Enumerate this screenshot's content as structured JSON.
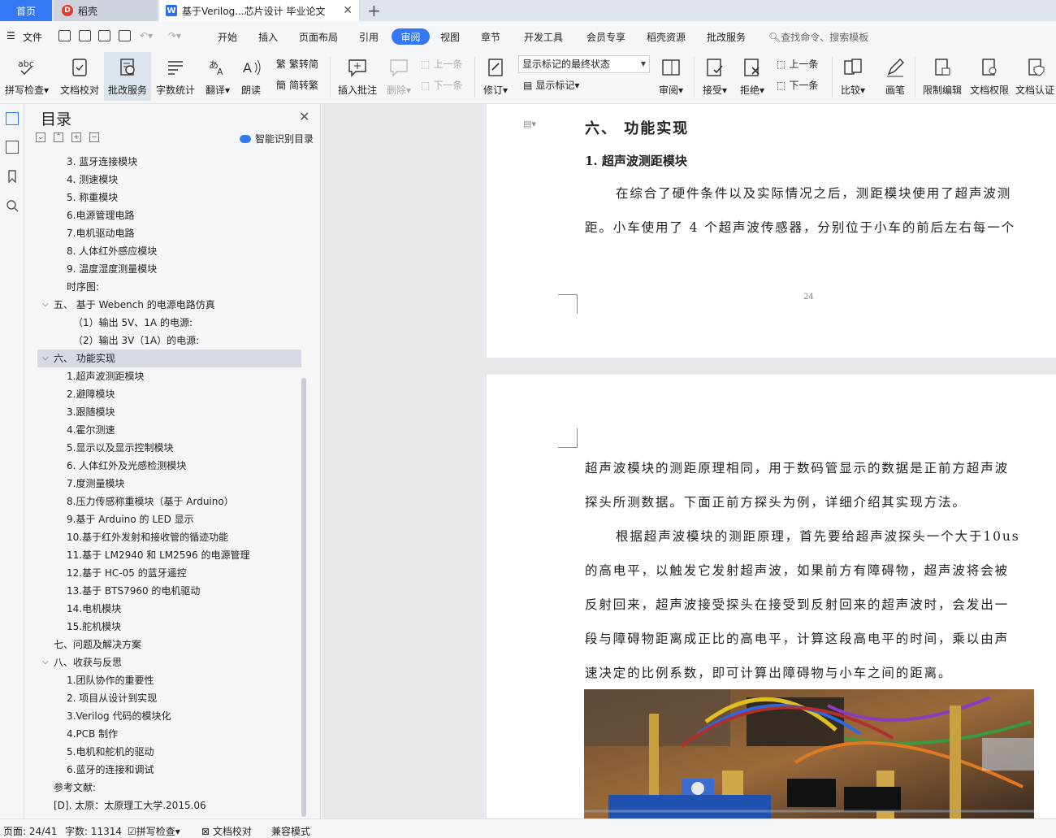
{
  "tabs": {
    "home": "首页",
    "daoke": "稻壳",
    "doc": "基于Verilog...芯片设计 毕业论文"
  },
  "menu": {
    "file": "文件",
    "items": [
      "开始",
      "插入",
      "页面布局",
      "引用",
      "审阅",
      "视图",
      "章节",
      "开发工具",
      "会员专享",
      "稻壳资源",
      "批改服务"
    ],
    "active": "审阅",
    "search": "查找命令、搜索模板"
  },
  "ribbon": {
    "spell": "拼写检查",
    "proof": "文档校对",
    "correct": "批改服务",
    "count": "字数统计",
    "translate": "翻译",
    "read": "朗读",
    "trad": "繁转简",
    "simp": "简转繁",
    "insert_comment": "插入批注",
    "delete": "删除",
    "prev_c": "上一条",
    "next_c": "下一条",
    "revise": "修订",
    "markup_state": "显示标记的最终状态",
    "show_markup": "显示标记",
    "review": "审阅",
    "accept": "接受",
    "reject": "拒绝",
    "prev": "上一条",
    "next": "下一条",
    "compare": "比较",
    "pen": "画笔",
    "restrict": "限制编辑",
    "rights": "文档权限",
    "auth": "文档认证"
  },
  "toc": {
    "title": "目录",
    "smart": "智能识别目录",
    "items": [
      {
        "text": "3. 蓝牙连接模块",
        "level": 2
      },
      {
        "text": "4. 测速模块",
        "level": 2
      },
      {
        "text": "5. 称重模块",
        "level": 2
      },
      {
        "text": "6.电源管理电路",
        "level": 2
      },
      {
        "text": "7.电机驱动电路",
        "level": 2
      },
      {
        "text": "8. 人体红外感应模块",
        "level": 2
      },
      {
        "text": "9. 温度湿度测量模块",
        "level": 2
      },
      {
        "text": "时序图:",
        "level": 2
      },
      {
        "text": "五、 基于 Webench 的电源电路仿真",
        "level": 1,
        "chev": true
      },
      {
        "text": "（1）输出 5V、1A 的电源:",
        "level": 3
      },
      {
        "text": "（2）输出 3V（1A）的电源:",
        "level": 3
      },
      {
        "text": "六、 功能实现",
        "level": 1,
        "chev": true,
        "sel": true
      },
      {
        "text": "1.超声波测距模块",
        "level": 2
      },
      {
        "text": "2.避障模块",
        "level": 2
      },
      {
        "text": "3.跟随模块",
        "level": 2
      },
      {
        "text": "4.霍尔测速",
        "level": 2
      },
      {
        "text": "5.显示以及显示控制模块",
        "level": 2
      },
      {
        "text": "6. 人体红外及光感检测模块",
        "level": 2
      },
      {
        "text": "7.度测量模块",
        "level": 2
      },
      {
        "text": "8.压力传感称重模块（基于 Arduino）",
        "level": 2
      },
      {
        "text": "9.基于 Arduino 的 LED 显示",
        "level": 2
      },
      {
        "text": "10.基于红外发射和接收管的循迹功能",
        "level": 2
      },
      {
        "text": "11.基于 LM2940 和 LM2596 的电源管理",
        "level": 2
      },
      {
        "text": "12.基于 HC-05 的蓝牙遥控",
        "level": 2
      },
      {
        "text": "13.基于 BTS7960 的电机驱动",
        "level": 2
      },
      {
        "text": "14.电机模块",
        "level": 2
      },
      {
        "text": "15.舵机模块",
        "level": 2
      },
      {
        "text": "七、问题及解决方案",
        "level": 1
      },
      {
        "text": "八、收获与反思",
        "level": 1,
        "chev": true
      },
      {
        "text": "1.团队协作的重要性",
        "level": 2
      },
      {
        "text": "2. 项目从设计到实现",
        "level": 2
      },
      {
        "text": "3.Verilog 代码的模块化",
        "level": 2
      },
      {
        "text": "4.PCB 制作",
        "level": 2
      },
      {
        "text": "5.电机和舵机的驱动",
        "level": 2
      },
      {
        "text": "6.蓝牙的连接和调试",
        "level": 2
      },
      {
        "text": "参考文献:",
        "level": 1
      },
      {
        "text": "[D]. 太原：太原理工大学.2015.06",
        "level": 1
      }
    ]
  },
  "doc": {
    "h1": "六、 功能实现",
    "h2": "1. 超声波测距模块",
    "p1a": "在综合了硬件条件以及实际情况之后，测距模块使用了超声波测",
    "p1b": "距。小车使用了 4 个超声波传感器，分别位于小车的前后左右每一个",
    "page_num": "24",
    "p2": [
      "超声波模块的测距原理相同，用于数码管显示的数据是正前方超声波",
      "探头所测数据。下面正前方探头为例，详细介绍其实现方法。"
    ],
    "p3": [
      "根据超声波模块的测距原理，首先要给超声波探头一个大于10us",
      "的高电平，以触发它发射超声波，如果前方有障碍物，超声波将会被",
      "反射回来，超声波接受探头在接受到反射回来的超声波时，会发出一",
      "段与障碍物距离成正比的高电平，计算这段高电平的时间，乘以由声",
      "速决定的比例系数，即可计算出障碍物与小车之间的距离。"
    ]
  },
  "status": {
    "page": "页面: 24/41",
    "words": "字数: 11314",
    "spell": "拼写检查",
    "proof": "文档校对",
    "compat": "兼容模式"
  }
}
